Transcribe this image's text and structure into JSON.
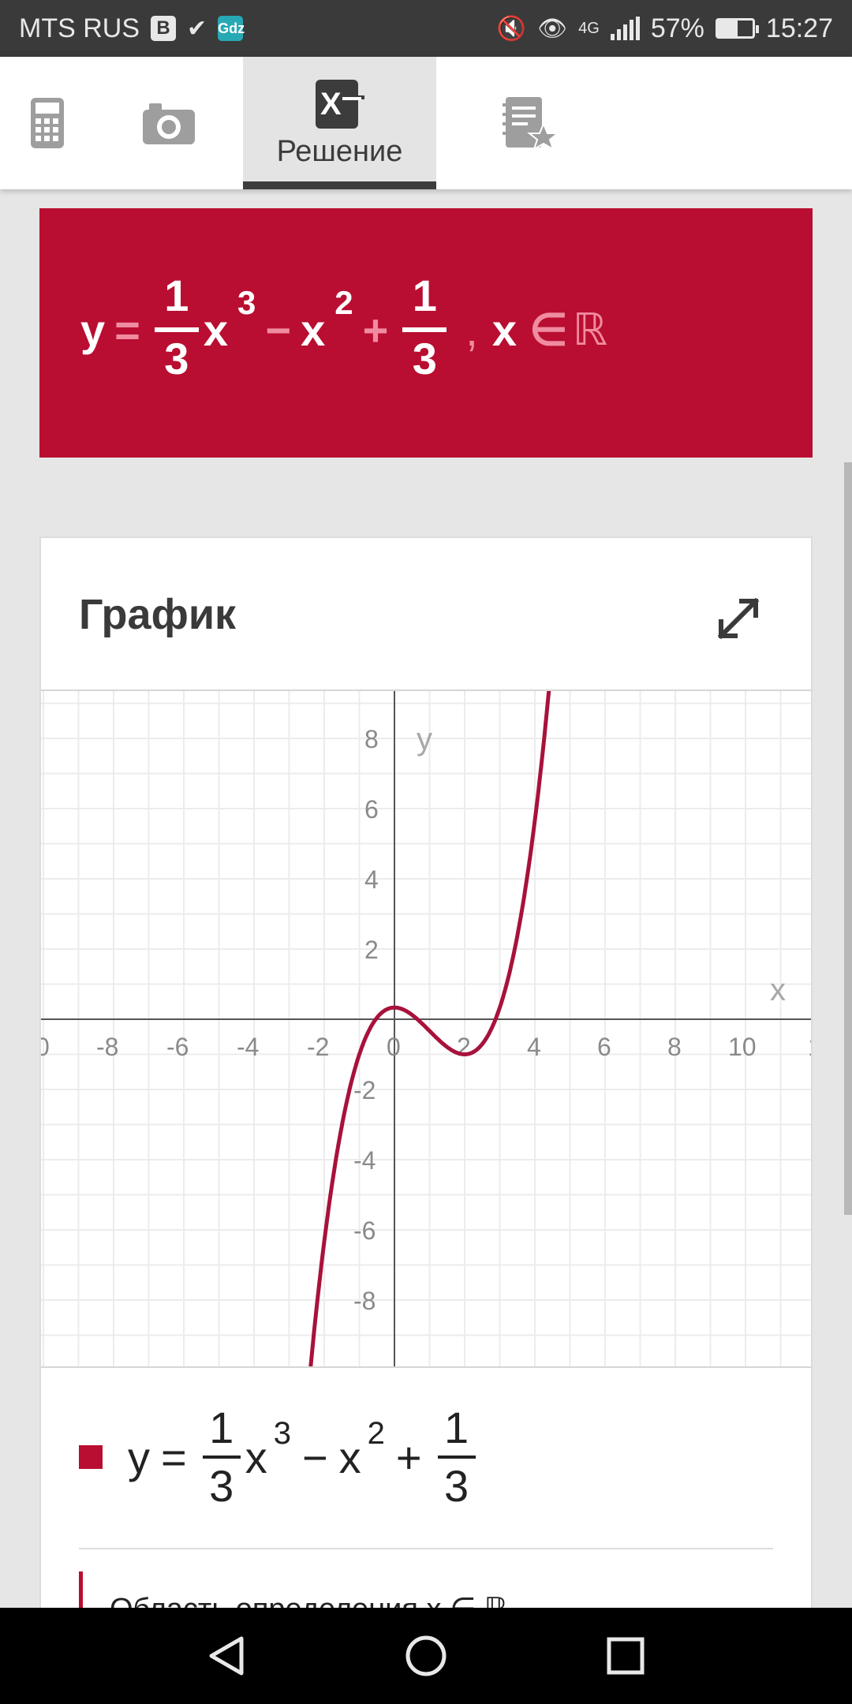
{
  "status_bar": {
    "carrier": "MTS RUS",
    "badge_1": "В",
    "badge_2": "Gdz",
    "network": "4G",
    "battery_percent": "57%",
    "battery_level": 0.57,
    "time": "15:27"
  },
  "tabs": [
    {
      "icon": "calculator-icon",
      "label": ""
    },
    {
      "icon": "camera-icon",
      "label": ""
    },
    {
      "icon": "solution-icon",
      "label": "Решение",
      "active": true
    },
    {
      "icon": "notebook-star-icon",
      "label": ""
    }
  ],
  "formula": {
    "y": "y",
    "eq": "=",
    "num1": "1",
    "den1": "3",
    "x1": "x",
    "exp1": "3",
    "minus": "−",
    "x2": "x",
    "exp2": "2",
    "plus": "+",
    "num2": "1",
    "den2": "3",
    "comma": ",",
    "x3": "x",
    "in": "∈",
    "set": "ℝ"
  },
  "graph": {
    "title": "График",
    "expand_icon": "expand-icon"
  },
  "chart_data": {
    "type": "line",
    "function": "y = 1/3 x^3 - x^2 + 1/3",
    "xlabel": "x",
    "ylabel": "y",
    "xlim": [
      -10,
      11.8
    ],
    "ylim": [
      -10,
      9.5
    ],
    "x_ticks": [
      "0",
      "-8",
      "-6",
      "-4",
      "-2",
      "0",
      "2",
      "4",
      "6",
      "8",
      "10",
      "1"
    ],
    "y_ticks": [
      "8",
      "6",
      "4",
      "2",
      "-2",
      "-4",
      "-6",
      "-8"
    ],
    "grid": true,
    "color": "#a8123a",
    "series": [
      {
        "x": [
          -2.45,
          -2.2,
          -2.0,
          -1.8,
          -1.6,
          -1.4,
          -1.2,
          -1.0,
          -0.8,
          -0.6,
          -0.4,
          -0.2,
          0,
          0.2,
          0.4,
          0.6,
          0.8,
          1.0,
          1.2,
          1.4,
          1.6,
          1.8,
          2.0,
          2.2,
          2.4,
          2.6,
          2.8,
          3.0,
          3.2,
          3.4,
          3.6,
          3.8,
          4.0,
          4.2,
          4.4
        ],
        "y": [
          -10.57,
          -8.06,
          -6.33,
          -4.86,
          -3.59,
          -2.54,
          -1.68,
          -1.0,
          -0.48,
          -0.1,
          0.15,
          0.29,
          0.33,
          0.3,
          0.19,
          0.04,
          -0.14,
          -0.33,
          -0.53,
          -0.71,
          -0.86,
          -0.96,
          -1.0,
          -0.97,
          -0.84,
          -0.56,
          -0.18,
          0.33,
          0.02,
          2.07,
          3.92,
          4.18,
          5.67,
          7.34,
          9.33
        ]
      }
    ]
  },
  "legend": {
    "y": "y",
    "eq": "=",
    "num1": "1",
    "den1": "3",
    "x1": "x",
    "exp1": "3",
    "minus": "−",
    "x2": "x",
    "exp2": "2",
    "plus": "+",
    "num2": "1",
    "den2": "3"
  },
  "domain": {
    "text": "Область определения   x ∈ ℝ"
  },
  "nav": {
    "back_icon": "back-icon",
    "home_icon": "home-icon",
    "recents_icon": "recents-icon"
  }
}
